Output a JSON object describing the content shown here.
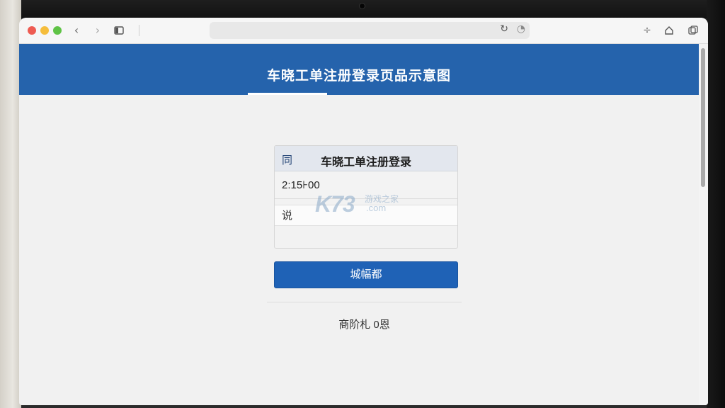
{
  "browser": {
    "toolbar_icons": [
      "back-icon",
      "forward-icon",
      "sidebar-icon",
      "reload-icon",
      "extension-icon",
      "share-icon",
      "home-icon",
      "tabs-icon"
    ],
    "address_value": ""
  },
  "header": {
    "title": "车晓工单注册登录页品示意图",
    "color": "#2563ac"
  },
  "login_card": {
    "icon_glyph": "同",
    "title": "车晓工单注册登录",
    "time_value": "2:15⊦00",
    "code_value": "说"
  },
  "submit": {
    "label": "城幅都",
    "color": "#1f62b6"
  },
  "footer": {
    "text": "商阶札 0恩"
  },
  "watermark": {
    "logo": "K73",
    "cn": "游戏之家",
    "com": ".com"
  }
}
